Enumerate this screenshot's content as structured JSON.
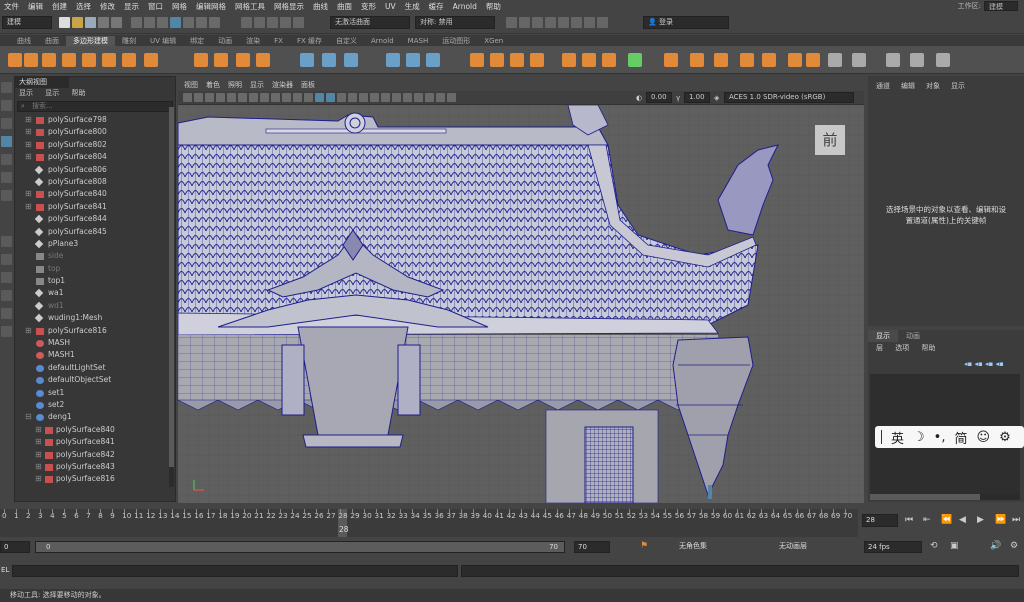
{
  "menubar": {
    "items": [
      "文件",
      "编辑",
      "创建",
      "选择",
      "修改",
      "显示",
      "窗口",
      "网格",
      "编辑网格",
      "网格工具",
      "网格显示",
      "曲线",
      "曲面",
      "变形",
      "UV",
      "生成",
      "缓存",
      "Arnold",
      "帮助"
    ],
    "workspace_label": "工作区:",
    "workspace_value": "建模"
  },
  "statusline": {
    "mode": "建模",
    "live_surface": "无激活曲面",
    "symmetry": "对称: 禁用",
    "login": "登录"
  },
  "shelf_tabs": [
    "曲线",
    "曲面",
    "多边形建模",
    "雕刻",
    "UV 编辑",
    "绑定",
    "动画",
    "渲染",
    "FX",
    "FX 缓存",
    "自定义",
    "Arnold",
    "MASH",
    "运动图形",
    "XGen"
  ],
  "shelf_active": "多边形建模",
  "outliner": {
    "title": "大纲视图",
    "menu": [
      "显示",
      "显示",
      "帮助"
    ],
    "search_placeholder": "搜索...",
    "rows": [
      {
        "label": "polySurface798",
        "type": "mesh",
        "plus": "⊞",
        "dim": false,
        "child": false
      },
      {
        "label": "polySurface800",
        "type": "mesh",
        "plus": "⊞",
        "dim": false,
        "child": false
      },
      {
        "label": "polySurface802",
        "type": "mesh",
        "plus": "⊞",
        "dim": false,
        "child": false
      },
      {
        "label": "polySurface804",
        "type": "mesh",
        "plus": "⊞",
        "dim": false,
        "child": false
      },
      {
        "label": "polySurface806",
        "type": "group",
        "plus": "",
        "dim": false,
        "child": false
      },
      {
        "label": "polySurface808",
        "type": "group",
        "plus": "",
        "dim": false,
        "child": false
      },
      {
        "label": "polySurface840",
        "type": "mesh",
        "plus": "⊞",
        "dim": false,
        "child": false
      },
      {
        "label": "polySurface841",
        "type": "mesh",
        "plus": "⊞",
        "dim": false,
        "child": false
      },
      {
        "label": "polySurface844",
        "type": "group",
        "plus": "",
        "dim": false,
        "child": false
      },
      {
        "label": "polySurface845",
        "type": "group",
        "plus": "",
        "dim": false,
        "child": false
      },
      {
        "label": "pPlane3",
        "type": "group",
        "plus": "",
        "dim": false,
        "child": false
      },
      {
        "label": "side",
        "type": "camera",
        "plus": "",
        "dim": true,
        "child": false
      },
      {
        "label": "top",
        "type": "camera",
        "plus": "",
        "dim": true,
        "child": false
      },
      {
        "label": "top1",
        "type": "camera",
        "plus": "",
        "dim": false,
        "child": false
      },
      {
        "label": "wa1",
        "type": "group",
        "plus": "",
        "dim": false,
        "child": false
      },
      {
        "label": "wd1",
        "type": "group",
        "plus": "",
        "dim": true,
        "child": false
      },
      {
        "label": "wuding1:Mesh",
        "type": "group",
        "plus": "",
        "dim": false,
        "child": false
      },
      {
        "label": "polySurface816",
        "type": "mesh",
        "plus": "⊞",
        "dim": false,
        "child": false
      },
      {
        "label": "MASH",
        "type": "mash",
        "plus": "",
        "dim": false,
        "child": false
      },
      {
        "label": "MASH1",
        "type": "mash",
        "plus": "",
        "dim": false,
        "child": false
      },
      {
        "label": "defaultLightSet",
        "type": "set",
        "plus": "",
        "dim": false,
        "child": false
      },
      {
        "label": "defaultObjectSet",
        "type": "set",
        "plus": "",
        "dim": false,
        "child": false
      },
      {
        "label": "set1",
        "type": "set",
        "plus": "",
        "dim": false,
        "child": false
      },
      {
        "label": "set2",
        "type": "set",
        "plus": "",
        "dim": false,
        "child": false
      },
      {
        "label": "deng1",
        "type": "set",
        "plus": "⊟",
        "dim": false,
        "child": false
      },
      {
        "label": "polySurface840",
        "type": "mesh",
        "plus": "⊞",
        "dim": false,
        "child": true
      },
      {
        "label": "polySurface841",
        "type": "mesh",
        "plus": "⊞",
        "dim": false,
        "child": true
      },
      {
        "label": "polySurface842",
        "type": "mesh",
        "plus": "⊞",
        "dim": false,
        "child": true
      },
      {
        "label": "polySurface843",
        "type": "mesh",
        "plus": "⊞",
        "dim": false,
        "child": true
      },
      {
        "label": "polySurface816",
        "type": "mesh",
        "plus": "⊞",
        "dim": false,
        "child": true
      }
    ]
  },
  "viewport": {
    "menu": [
      "视图",
      "着色",
      "照明",
      "显示",
      "渲染器",
      "面板"
    ],
    "exposure": "0.00",
    "gamma": "1.00",
    "colorspace": "ACES 1.0 SDR-video (sRGB)",
    "view_label": "前"
  },
  "attribute_editor": {
    "menu": [
      "通道",
      "编辑",
      "对象",
      "显示"
    ],
    "message_line1": "选择场景中的对象以查看、编辑和设",
    "message_line2": "置通道(属性)上的关键帧"
  },
  "layer_editor": {
    "tabs": [
      "显示",
      "动画"
    ],
    "menu": [
      "层",
      "选项",
      "帮助"
    ]
  },
  "ime": {
    "items": [
      "英",
      "☽",
      "•,",
      "简",
      "☺",
      "⚙"
    ]
  },
  "timeline": {
    "ticks": [
      0,
      1,
      2,
      3,
      4,
      5,
      6,
      7,
      8,
      9,
      10,
      11,
      12,
      13,
      14,
      15,
      16,
      17,
      18,
      19,
      20,
      21,
      22,
      23,
      24,
      25,
      26,
      27,
      28,
      29,
      30,
      31,
      32,
      33,
      34,
      35,
      36,
      37,
      38,
      39,
      40,
      41,
      42,
      43,
      44,
      45,
      46,
      47,
      48,
      49,
      50,
      51,
      52,
      53,
      54,
      55,
      56,
      57,
      58,
      59,
      60,
      61,
      62,
      63,
      64,
      65,
      66,
      67,
      68,
      69,
      70
    ],
    "current_frame": "28",
    "current_frame_value": "28"
  },
  "range": {
    "start": "0",
    "anim_start": "0",
    "anim_end": "70",
    "end": "70",
    "char_set": "无角色集",
    "anim_layer": "无动画层",
    "fps": "24 fps"
  },
  "cmd": {
    "label": "EL"
  },
  "helpline": {
    "text": "移动工具: 选择要移动的对象。"
  },
  "colors": {
    "accent": "#5285a6",
    "wire": "#1e1e8c",
    "bg": "#5f5f5f"
  }
}
